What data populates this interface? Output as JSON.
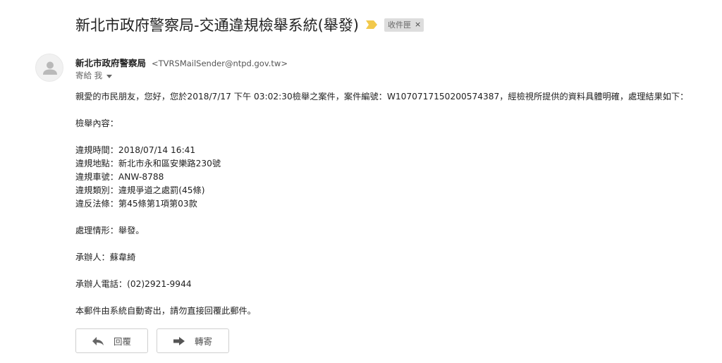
{
  "subject": "新北市政府警察局-交通違規檢舉系統(舉發)",
  "label": {
    "name": "收件匣",
    "remove": "×"
  },
  "sender": {
    "name": "新北市政府警察局",
    "email": "<TVRSMailSender@ntpd.gov.tw>"
  },
  "recipient": {
    "text": "寄給 我"
  },
  "body_lines": [
    "親愛的市民朋友，您好，您於2018/7/17 下午 03:02:30檢舉之案件，案件編號：W1070717150200574387，經檢視所提供的資料具體明確，處理結果如下：",
    "檢舉內容：",
    "違規時間：2018/07/14 16:41",
    "違規地點：新北市永和區安樂路230號",
    "違規車號：ANW-8788",
    "違規類別：違規爭道之處罰(45條)",
    "違反法條：第45條第1項第03款",
    "處理情形：舉發。",
    "承辦人：蘇韋綺",
    "承辦人電話：(02)2921-9944",
    "本郵件由系統自動寄出，請勿直接回覆此郵件。"
  ],
  "actions": {
    "reply": "回覆",
    "forward": "轉寄"
  },
  "icons": {
    "importance": "importance-marker-icon",
    "avatar": "person-icon",
    "reply": "reply-arrow-icon",
    "forward": "forward-arrow-icon",
    "caret": "chevron-down-icon"
  },
  "colors": {
    "importance": "#f2c94c"
  }
}
